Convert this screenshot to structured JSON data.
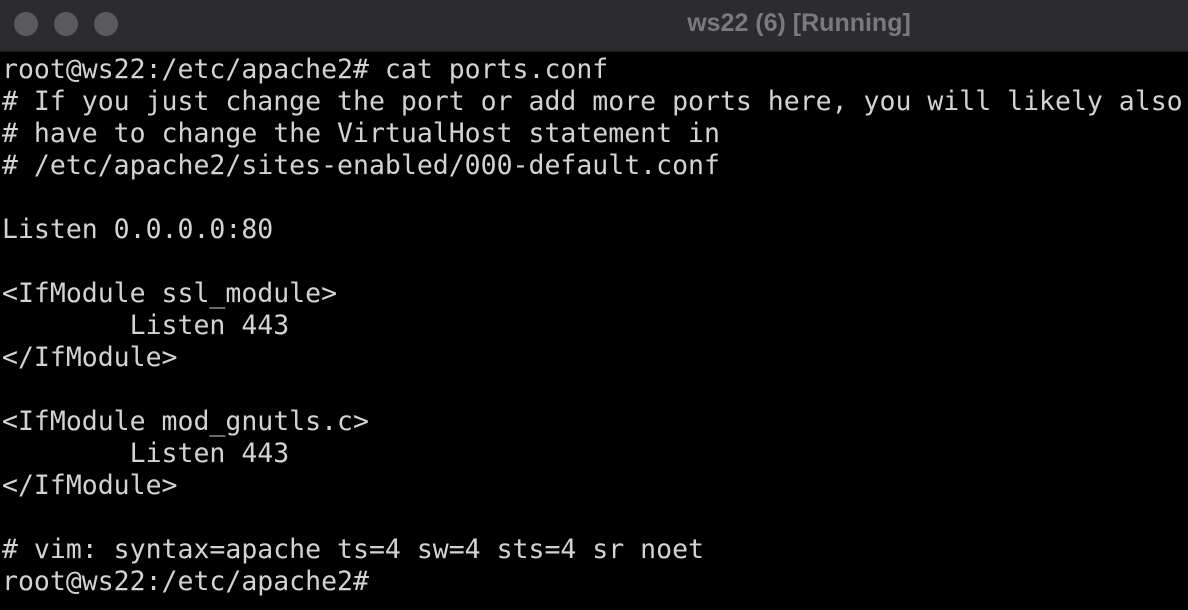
{
  "window": {
    "title": "ws22 (6) [Running]"
  },
  "terminal": {
    "lines": [
      "root@ws22:/etc/apache2# cat ports.conf",
      "# If you just change the port or add more ports here, you will likely also",
      "# have to change the VirtualHost statement in",
      "# /etc/apache2/sites-enabled/000-default.conf",
      "",
      "Listen 0.0.0.0:80",
      "",
      "<IfModule ssl_module>",
      "        Listen 443",
      "</IfModule>",
      "",
      "<IfModule mod_gnutls.c>",
      "        Listen 443",
      "</IfModule>",
      "",
      "# vim: syntax=apache ts=4 sw=4 sts=4 sr noet",
      "root@ws22:/etc/apache2#"
    ]
  },
  "colors": {
    "background": "#000000",
    "text": "#d3d3d3",
    "titlebar": "#2c2c2e",
    "title_text": "#7a7a7c",
    "traffic_light": "#5a5a5c"
  }
}
